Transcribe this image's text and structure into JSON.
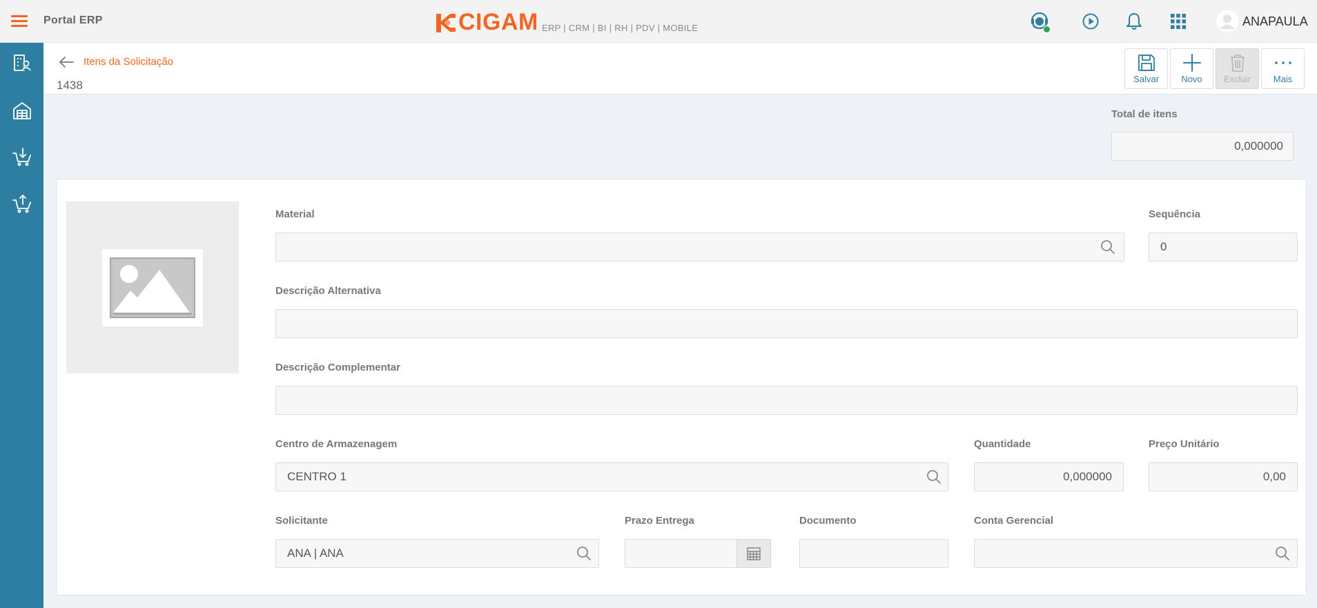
{
  "header": {
    "portal_title": "Portal ERP",
    "logo_text": "CIGAM",
    "logo_subtitle": "ERP | CRM | BI | RH | PDV | MOBILE",
    "user_name": "ANAPAULA",
    "accent_color": "#f26522",
    "primary_color": "#2d7ea1"
  },
  "sidebar": {
    "items": [
      {
        "icon": "building-user-icon"
      },
      {
        "icon": "warehouse-icon"
      },
      {
        "icon": "cart-download-icon"
      },
      {
        "icon": "cart-upload-icon"
      }
    ]
  },
  "page": {
    "breadcrumb": "Itens da Solicitação",
    "record_id": "1438"
  },
  "toolbar": {
    "save_label": "Salvar",
    "new_label": "Novo",
    "delete_label": "Excluir",
    "more_label": "Mais"
  },
  "summary": {
    "total_label": "Total de itens",
    "total_value": "0,000000"
  },
  "form": {
    "material": {
      "label": "Material",
      "value": ""
    },
    "sequencia": {
      "label": "Sequência",
      "value": "0"
    },
    "descricao_alternativa": {
      "label": "Descrição Alternativa",
      "value": ""
    },
    "descricao_complementar": {
      "label": "Descrição Complementar",
      "value": ""
    },
    "centro_armazenagem": {
      "label": "Centro de Armazenagem",
      "value": "CENTRO 1"
    },
    "quantidade": {
      "label": "Quantidade",
      "value": "0,000000"
    },
    "preco_unitario": {
      "label": "Preço Unitário",
      "value": "0,00"
    },
    "solicitante": {
      "label": "Solicitante",
      "value": "ANA | ANA"
    },
    "prazo_entrega": {
      "label": "Prazo Entrega",
      "value": ""
    },
    "documento": {
      "label": "Documento",
      "value": ""
    },
    "conta_gerencial": {
      "label": "Conta Gerencial",
      "value": ""
    }
  }
}
